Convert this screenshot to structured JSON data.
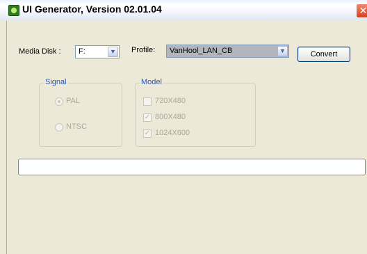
{
  "window": {
    "title": "UI Generator, Version 02.01.04",
    "close_glyph": "✕"
  },
  "toolbar": {
    "media_disk_label": "Media Disk :",
    "media_disk_value": "F:",
    "profile_label": "Profile:",
    "profile_value": "VanHool_LAN_CB",
    "convert_label": "Convert"
  },
  "signal": {
    "title": "Signal",
    "options": [
      {
        "label": "PAL",
        "selected": true
      },
      {
        "label": "NTSC",
        "selected": false
      }
    ]
  },
  "model": {
    "title": "Model",
    "options": [
      {
        "label": "720X480",
        "checked": false
      },
      {
        "label": "800X480",
        "checked": true
      },
      {
        "label": "1024X600",
        "checked": true
      }
    ]
  },
  "progress": {
    "value": 0
  }
}
